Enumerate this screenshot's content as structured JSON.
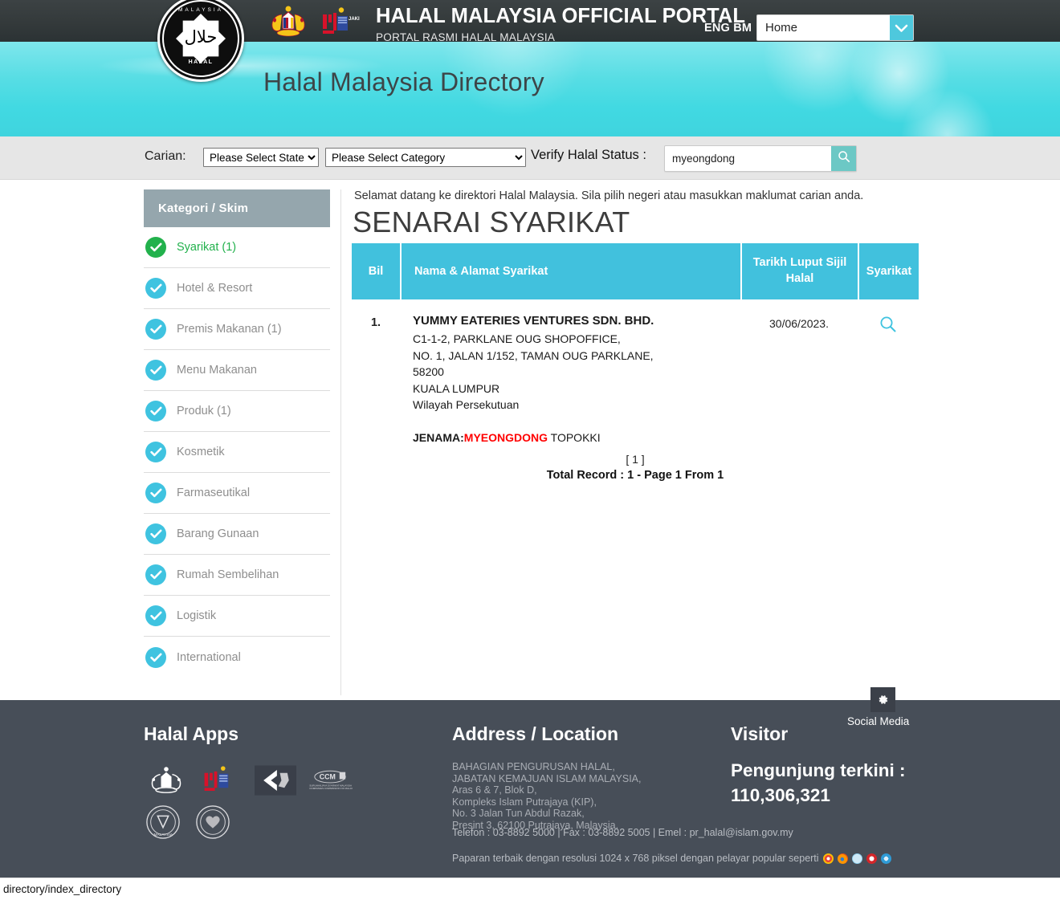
{
  "header": {
    "portal_title": "HALAL MALAYSIA OFFICIAL PORTAL",
    "portal_subtitle": "PORTAL RASMI HALAL MALAYSIA",
    "lang_eng": "ENG",
    "lang_bm": "BM",
    "menu_selected": "Home",
    "logo_text_top": "MALAYSIA",
    "logo_text_label": "HALAL",
    "logo_arabic": "حلال"
  },
  "banner": {
    "title": "Halal Malaysia Directory"
  },
  "search": {
    "carian_label": "Carian:",
    "state_selected": "Please Select State",
    "category_selected": "Please Select Category",
    "verify_label": "Verify Halal Status :",
    "query_value": "myeongdong",
    "query_placeholder": "",
    "search_icon": "search-icon"
  },
  "sidebar": {
    "heading": "Kategori / Skim",
    "items": [
      {
        "label": "Syarikat (1)",
        "active": true
      },
      {
        "label": "Hotel & Resort",
        "active": false
      },
      {
        "label": "Premis Makanan (1)",
        "active": false
      },
      {
        "label": "Menu Makanan",
        "active": false
      },
      {
        "label": "Produk (1)",
        "active": false
      },
      {
        "label": "Kosmetik",
        "active": false
      },
      {
        "label": "Farmaseutikal",
        "active": false
      },
      {
        "label": "Barang Gunaan",
        "active": false
      },
      {
        "label": "Rumah Sembelihan",
        "active": false
      },
      {
        "label": "Logistik",
        "active": false
      },
      {
        "label": "International",
        "active": false
      }
    ]
  },
  "content": {
    "welcome": "Selamat datang ke direktori Halal Malaysia. Sila pilih negeri atau masukkan maklumat carian anda.",
    "page_title": "SENARAI SYARIKAT",
    "table": {
      "columns": [
        "Bil",
        "Nama & Alamat Syarikat",
        "Tarikh Luput Sijil Halal",
        "Syarikat"
      ],
      "rows": [
        {
          "bil": "1.",
          "company": "YUMMY EATERIES VENTURES SDN. BHD.",
          "address": [
            "C1-1-2, PARKLANE OUG SHOPOFFICE,",
            "NO. 1, JALAN 1/152, TAMAN OUG PARKLANE,",
            "58200",
            "KUALA LUMPUR",
            "Wilayah Persekutuan"
          ],
          "jenama_label": "JENAMA:",
          "jenama_highlight": "MYEONGDONG",
          "jenama_rest": " TOPOKKI",
          "expiry": "30/06/2023.",
          "action_icon": "search-icon"
        }
      ]
    },
    "pagination": "[ 1 ]",
    "total_record": "Total Record : 1 - Page 1 From 1"
  },
  "footer": {
    "apps_heading": "Halal Apps",
    "address_heading": "Address / Location",
    "address_lines": [
      "BAHAGIAN PENGURUSAN HALAL,",
      "JABATAN KEMAJUAN ISLAM MALAYSIA,",
      "Aras 6 & 7, Blok D,",
      "Kompleks Islam Putrajaya (KIP),",
      "No. 3 Jalan Tun Abdul Razak,",
      "Presint 3, 62100 Putrajaya, Malaysia."
    ],
    "contact": "Telefon : 03-8892 5000 | Fax : 03-8892 5005 | Emel : pr_halal@islam.gov.my",
    "browser_note": "Paparan terbaik dengan resolusi 1024 x 768 piksel dengan pelayar popular seperti",
    "visitor_heading": "Visitor",
    "visitor_label": "Pengunjung terkini :",
    "visitor_count": "110,306,321",
    "social_label": "Social Media",
    "gear_icon": "gear-icon"
  },
  "statusbar": {
    "url": "directory/index_directory"
  },
  "colors": {
    "accent_cyan": "#41c1dd",
    "banner_cyan": "#4fdde4",
    "active_green": "#22b14c",
    "footer_dark": "#474e58",
    "header_dark": "#343a3b",
    "highlight_red": "#ff0000",
    "search_btn_teal": "#6cc8c5",
    "sidebar_head_gray": "#95a6ad"
  }
}
